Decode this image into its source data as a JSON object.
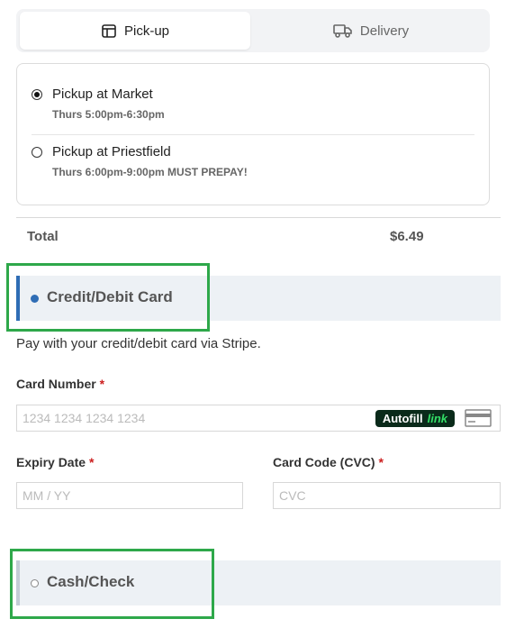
{
  "tabs": [
    {
      "label": "Pick-up",
      "icon": "store-icon",
      "active": true
    },
    {
      "label": "Delivery",
      "icon": "truck-icon",
      "active": false
    }
  ],
  "pickup_options": [
    {
      "label": "Pickup at Market",
      "schedule": "Thurs 5:00pm-6:30pm",
      "selected": true
    },
    {
      "label": "Pickup at Priestfield",
      "schedule": "Thurs 6:00pm-9:00pm MUST PREPAY!",
      "selected": false
    }
  ],
  "total": {
    "label": "Total",
    "value": "$6.49"
  },
  "payment_methods": [
    {
      "label": "Credit/Debit Card",
      "selected": true
    },
    {
      "label": "Cash/Check",
      "selected": false
    }
  ],
  "card_form": {
    "description": "Pay with your credit/debit card via Stripe.",
    "card_number_label": "Card Number",
    "card_number_placeholder": "1234 1234 1234 1234",
    "autofill_label": "Autofill",
    "autofill_link": "link",
    "expiry_label": "Expiry Date",
    "expiry_placeholder": "MM / YY",
    "cvc_label": "Card Code (CVC)",
    "cvc_placeholder": "CVC",
    "required_mark": "*"
  },
  "colors": {
    "accent_blue": "#2f6db5",
    "highlight_green": "#2ea84a",
    "required_red": "#cc1f1f"
  }
}
